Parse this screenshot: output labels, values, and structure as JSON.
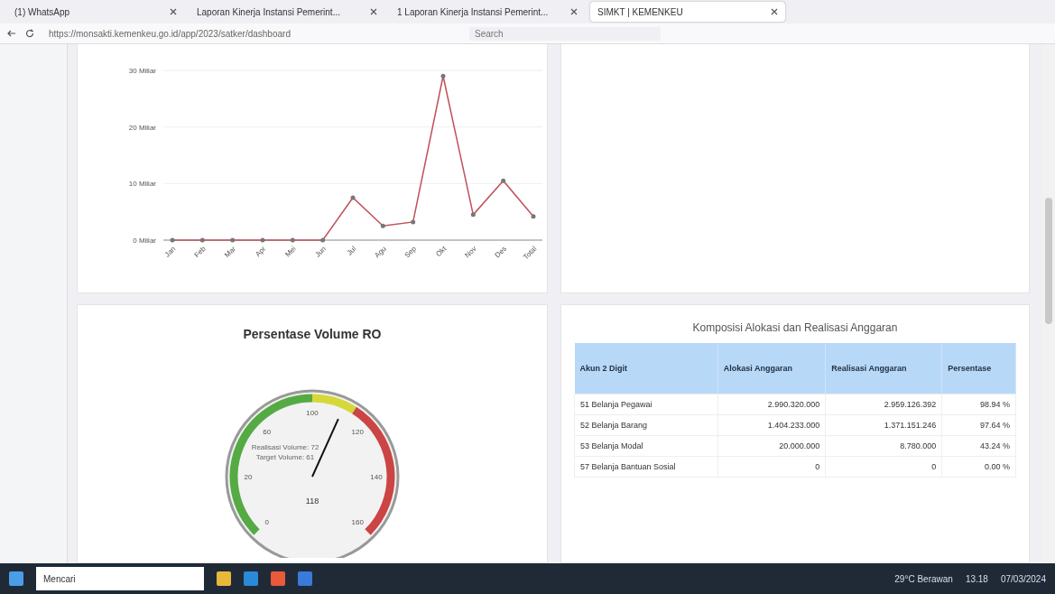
{
  "browser": {
    "tabs": [
      {
        "label": "(1) WhatsApp",
        "selected": false
      },
      {
        "label": "Laporan Kinerja Instansi Pemerint...",
        "selected": false
      },
      {
        "label": "1 Laporan Kinerja Instansi Pemerint...",
        "selected": false
      },
      {
        "label": "SIMKT | KEMENKEU",
        "selected": true
      }
    ],
    "address": "https://monsakti.kemenkeu.go.id/app/2023/satker/dashboard",
    "search": {
      "placeholder": "Search"
    }
  },
  "line_chart": {
    "chart_data": {
      "type": "line",
      "categories": [
        "Jan",
        "Feb",
        "Mar",
        "Apr",
        "Mei",
        "Jun",
        "Jul",
        "Agu",
        "Sep",
        "Okt",
        "Nov",
        "Des",
        "Total"
      ],
      "series": [
        {
          "color": "#c0505a",
          "values": [
            0,
            0,
            0,
            0,
            0,
            0,
            7.5,
            2.5,
            3.2,
            29,
            4.5,
            10.5,
            4.2
          ]
        }
      ],
      "ylim": [
        0,
        30
      ],
      "yticks": [
        {
          "value": 0,
          "label": "0 Miliar"
        },
        {
          "value": 10,
          "label": "10 Miliar"
        },
        {
          "value": 20,
          "label": "20 Miliar"
        },
        {
          "value": 30,
          "label": "30 Miliar"
        }
      ]
    }
  },
  "gauge": {
    "title": "Persentase Volume RO",
    "ticks": [
      "0",
      "20",
      "60",
      "100",
      "120",
      "140",
      "160"
    ],
    "caption": [
      "Realisasi Volume: 72",
      "Target Volume: 61"
    ],
    "value": "118",
    "level": 0.59
  },
  "table": {
    "title": "Komposisi Alokasi dan Realisasi Anggaran",
    "columns": [
      "Akun 2 Digit",
      "Alokasi Anggaran",
      "Realisasi Anggaran",
      "Persentase"
    ],
    "rows": [
      [
        "51 Belanja Pegawai",
        "2.990.320.000",
        "2.959.126.392",
        "98.94 %"
      ],
      [
        "52 Belanja Barang",
        "1.404.233.000",
        "1.371.151.246",
        "97.64 %"
      ],
      [
        "53 Belanja Modal",
        "20.000.000",
        "8.780.000",
        "43.24 %"
      ],
      [
        "57 Belanja Bantuan Sosial",
        "0",
        "0",
        "0.00 %"
      ]
    ]
  },
  "taskbar": {
    "search": "Mencari",
    "weather": "29°C Berawan",
    "time": "13.18",
    "date": "07/03/2024"
  }
}
